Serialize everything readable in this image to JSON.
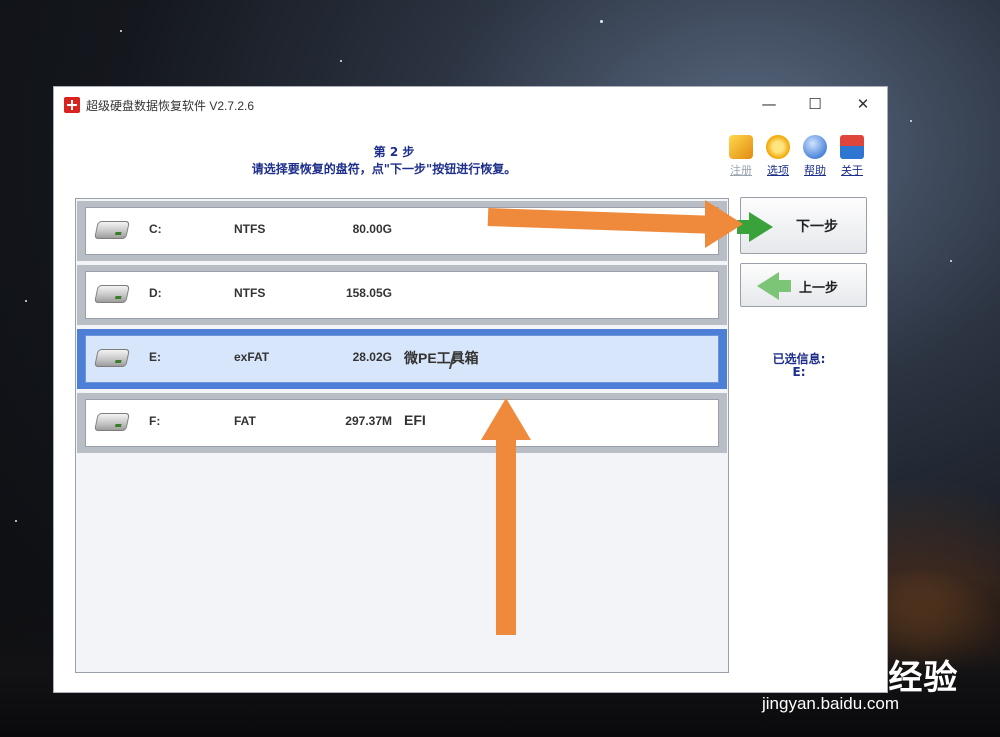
{
  "window": {
    "title": "超级硬盘数据恢复软件 V2.7.2.6",
    "controls": {
      "minimize": "—",
      "maximize": "☐",
      "close": "✕"
    }
  },
  "header": {
    "step": "第 2 步",
    "instruction": "请选择要恢复的盘符，点\"下一步\"按钮进行恢复。"
  },
  "toolbar": [
    {
      "label": "注册",
      "icon": "cart-icon",
      "enabled": false
    },
    {
      "label": "选项",
      "icon": "gear-icon",
      "enabled": true
    },
    {
      "label": "帮助",
      "icon": "help-icon",
      "enabled": true
    },
    {
      "label": "关于",
      "icon": "house-icon",
      "enabled": true
    }
  ],
  "drives": [
    {
      "letter": "C:",
      "fs": "NTFS",
      "size": "80.00G",
      "label": "",
      "selected": false
    },
    {
      "letter": "D:",
      "fs": "NTFS",
      "size": "158.05G",
      "label": "",
      "selected": false
    },
    {
      "letter": "E:",
      "fs": "exFAT",
      "size": "28.02G",
      "label": "微PE工具箱",
      "selected": true
    },
    {
      "letter": "F:",
      "fs": "FAT",
      "size": "297.37M",
      "label": "EFI",
      "selected": false
    }
  ],
  "buttons": {
    "next": "下一步",
    "prev": "上一步"
  },
  "selected_info": {
    "label": "已选信息:",
    "value": "E:"
  },
  "annotation": {
    "arrow_color": "#ef8a3c"
  },
  "watermark": {
    "logo": "Bai du 经验",
    "url": "jingyan.baidu.com"
  }
}
